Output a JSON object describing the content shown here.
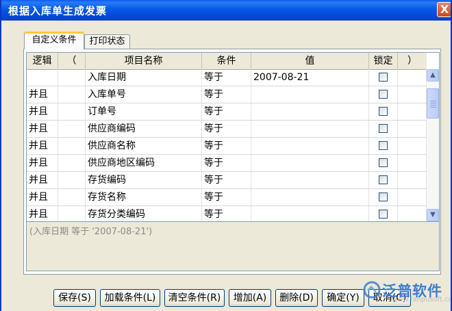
{
  "window": {
    "title": "根据入库单生成发票",
    "close_symbol": "X"
  },
  "tabs": [
    {
      "label": "自定义条件",
      "active": true
    },
    {
      "label": "打印状态",
      "active": false
    }
  ],
  "grid": {
    "columns": [
      "逻辑",
      "（",
      "项目名称",
      "条件",
      "值",
      "锁定",
      "）"
    ],
    "rows": [
      {
        "logic": "",
        "paren_open": "",
        "field": "入库日期",
        "condition": "等于",
        "value": "2007-08-21",
        "locked": false,
        "paren_close": ""
      },
      {
        "logic": "并且",
        "paren_open": "",
        "field": "入库单号",
        "condition": "等于",
        "value": "",
        "locked": false,
        "paren_close": ""
      },
      {
        "logic": "并且",
        "paren_open": "",
        "field": "订单号",
        "condition": "等于",
        "value": "",
        "locked": false,
        "paren_close": ""
      },
      {
        "logic": "并且",
        "paren_open": "",
        "field": "供应商编码",
        "condition": "等于",
        "value": "",
        "locked": false,
        "paren_close": ""
      },
      {
        "logic": "并且",
        "paren_open": "",
        "field": "供应商名称",
        "condition": "等于",
        "value": "",
        "locked": false,
        "paren_close": ""
      },
      {
        "logic": "并且",
        "paren_open": "",
        "field": "供应商地区编码",
        "condition": "等于",
        "value": "",
        "locked": false,
        "paren_close": ""
      },
      {
        "logic": "并且",
        "paren_open": "",
        "field": "存货编码",
        "condition": "等于",
        "value": "",
        "locked": false,
        "paren_close": ""
      },
      {
        "logic": "并且",
        "paren_open": "",
        "field": "存货名称",
        "condition": "等于",
        "value": "",
        "locked": false,
        "paren_close": ""
      },
      {
        "logic": "并且",
        "paren_open": "",
        "field": "存货分类编码",
        "condition": "等于",
        "value": "",
        "locked": false,
        "paren_close": ""
      }
    ]
  },
  "expression": "(入库日期 等于 '2007-08-21')",
  "buttons": {
    "save": "保存(S)",
    "load": "加载条件(L)",
    "clear": "清空条件(R)",
    "add": "增加(A)",
    "delete": "删除(D)",
    "ok": "确定(Y)",
    "cancel": "取消(C)"
  },
  "watermark": {
    "name": "泛普软件",
    "url": "www.fanpusoft.com"
  },
  "colors": {
    "title_bar": "#0758e6",
    "tab_highlight": "#ffc83c",
    "watermark": "#3d7dcf"
  }
}
